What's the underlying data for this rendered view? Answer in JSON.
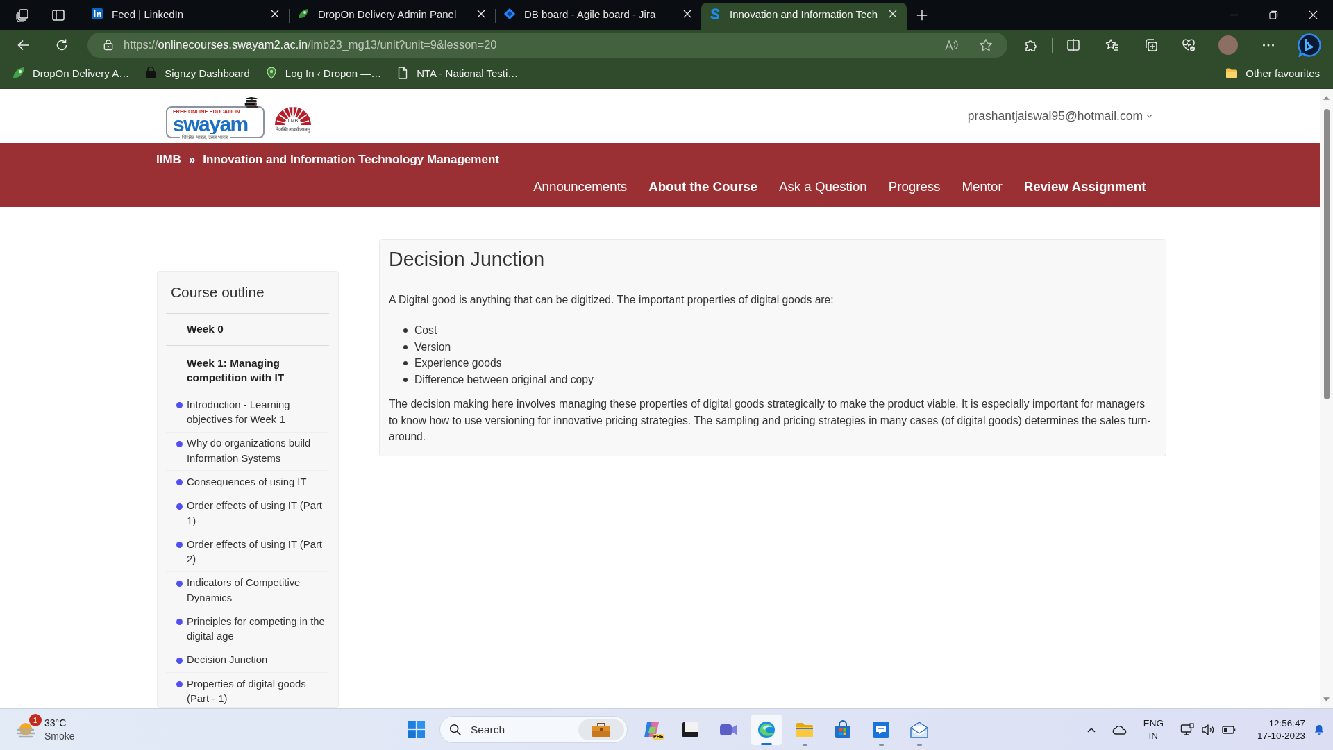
{
  "browser": {
    "tabs": [
      {
        "title": "Feed | LinkedIn",
        "selected": false
      },
      {
        "title": "DropOn Delivery Admin Panel",
        "selected": false
      },
      {
        "title": "DB board - Agile board - Jira",
        "selected": false
      },
      {
        "title": "Innovation and Information Tech",
        "selected": true
      }
    ],
    "address": {
      "scheme": "https://",
      "host": "onlinecourses.swayam2.ac.in",
      "path": "/imb23_mg13/unit?unit=9&lesson=20"
    },
    "bookmarks": [
      "DropOn Delivery A…",
      "Signzy Dashboard",
      "Log In ‹ Dropon —…",
      "NTA - National Testi…"
    ],
    "other_bookmarks": "Other favourites"
  },
  "header": {
    "logo": {
      "tagline": "FREE ONLINE EDUCATION",
      "name": "swayam",
      "motto": "शिक्षित भारत, उन्नत भारत"
    },
    "institute_logo": {
      "name": "IIMB",
      "motto": "तेजस्वि नावधीतमस्तु"
    },
    "account": "prashantjaiswal95@hotmail.com"
  },
  "course_bar": {
    "breadcrumb": [
      "IIMB",
      "Innovation and Information Technology Management"
    ],
    "separator": "»",
    "nav": [
      {
        "label": "Announcements",
        "emphasized": false
      },
      {
        "label": "About the Course",
        "emphasized": true
      },
      {
        "label": "Ask a Question",
        "emphasized": false
      },
      {
        "label": "Progress",
        "emphasized": false
      },
      {
        "label": "Mentor",
        "emphasized": false
      },
      {
        "label": "Review Assignment",
        "emphasized": true
      }
    ]
  },
  "sidebar": {
    "title": "Course outline",
    "weeks": [
      {
        "title": "Week 0"
      },
      {
        "title": "Week 1: Managing competition with IT",
        "lessons": [
          "Introduction - Learning objectives for Week 1",
          "Why do organizations build Information Systems",
          "Consequences of using IT",
          "Order effects of using IT (Part 1)",
          "Order effects of using IT (Part 2)",
          "Indicators of Competitive Dynamics",
          "Principles for competing in the digital age",
          "Decision Junction",
          "Properties of digital goods (Part - 1)"
        ]
      }
    ]
  },
  "lesson": {
    "title": "Decision Junction",
    "intro": "A Digital good is anything that can be digitized. The important properties of digital goods are:",
    "points": [
      "Cost",
      "Version",
      "Experience goods",
      "Difference between original and copy"
    ],
    "body": "The decision making here involves managing these properties of digital goods strategically to make the product viable. It is especially important for managers to know how to use versioning for innovative pricing strategies. The sampling and pricing strategies in many cases (of digital goods) determines the sales turn-around."
  },
  "taskbar": {
    "weather": {
      "alerts": "1",
      "temperature": "33°C",
      "condition": "Smoke"
    },
    "search": {
      "placeholder": "Search"
    },
    "apps": [
      {
        "badge": "PRE",
        "running": false,
        "selected": false
      },
      {
        "running": false,
        "selected": false
      },
      {
        "running": false,
        "selected": false
      },
      {
        "running": true,
        "selected": true
      },
      {
        "running": true,
        "selected": false
      },
      {
        "running": false,
        "selected": false
      },
      {
        "running": true,
        "selected": false
      },
      {
        "running": true,
        "selected": false
      }
    ],
    "language": "ENG",
    "region": "IN",
    "time": "12:56:47",
    "date": "17-10-2023"
  }
}
